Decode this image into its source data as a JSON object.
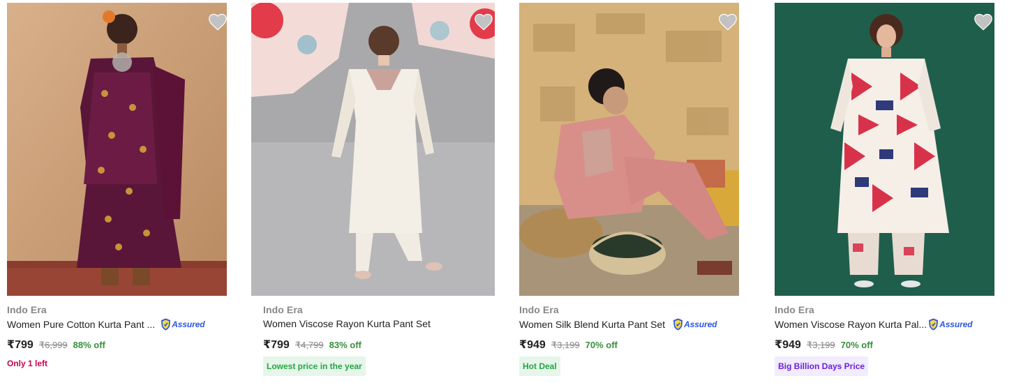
{
  "colors": {
    "price_off": "#388e3c",
    "stock_warning": "#c7044c",
    "badge_green_bg": "#e6f6ea",
    "badge_green_text": "#26a541",
    "badge_purple_bg": "#f1ecff",
    "badge_purple_text": "#6b1fd6",
    "assured_blue": "#2a55e5"
  },
  "products": [
    {
      "brand": "Indo Era",
      "title": "Women Pure Cotton Kurta Pant ...",
      "assured": "Assured",
      "price": "₹799",
      "mrp": "₹6,999",
      "discount": "88% off",
      "note": "Only 1 left",
      "wishlist_icon": "heart-icon"
    },
    {
      "brand": "Indo Era",
      "title": "Women Viscose Rayon Kurta Pant Set",
      "price": "₹799",
      "mrp": "₹4,799",
      "discount": "83% off",
      "badge": "Lowest price in the year",
      "wishlist_icon": "heart-icon"
    },
    {
      "brand": "Indo Era",
      "title": "Women Silk Blend Kurta Pant Set",
      "assured": "Assured",
      "price": "₹949",
      "mrp": "₹3,199",
      "discount": "70% off",
      "badge": "Hot Deal",
      "wishlist_icon": "heart-icon"
    },
    {
      "brand": "Indo Era",
      "title": "Women Viscose Rayon Kurta Pal...",
      "assured": "Assured",
      "price": "₹949",
      "mrp": "₹3,199",
      "discount": "70% off",
      "badge": "Big Billion Days Price",
      "wishlist_icon": "heart-icon"
    }
  ]
}
